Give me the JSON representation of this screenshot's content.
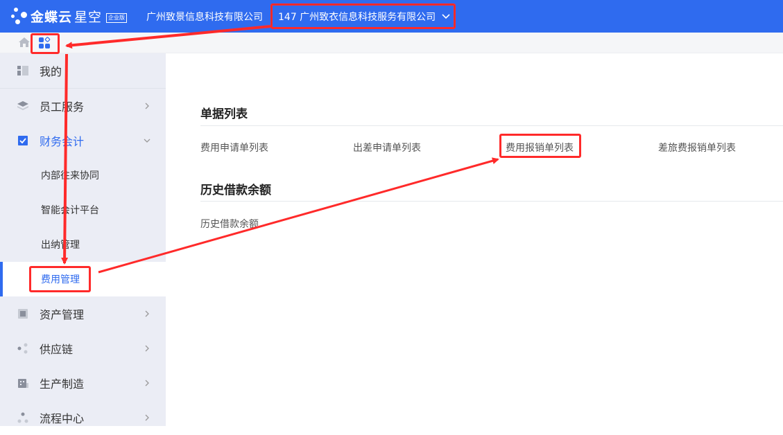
{
  "topbar": {
    "brand": "金蝶云",
    "brand_sub": "星空",
    "edition_badge": "企业版",
    "org_name": "广州致景信息科技有限公司",
    "account_selector": "147 广州致衣信息科技服务有限公司"
  },
  "breadcrumb": {
    "home_icon": "home-icon",
    "apps_icon": "apps-grid-icon"
  },
  "sidebar": {
    "items": [
      {
        "label": "我的",
        "icon": "dashboard-icon"
      },
      {
        "label": "员工服务",
        "icon": "layers-icon"
      },
      {
        "label": "财务会计",
        "icon": "ledger-icon"
      },
      {
        "label": "资产管理",
        "icon": "asset-icon"
      },
      {
        "label": "供应链",
        "icon": "supply-chain-icon"
      },
      {
        "label": "生产制造",
        "icon": "factory-icon"
      },
      {
        "label": "流程中心",
        "icon": "flow-icon"
      }
    ],
    "finance_subitems": [
      {
        "label": "内部往来协同"
      },
      {
        "label": "智能会计平台"
      },
      {
        "label": "出纳管理"
      },
      {
        "label": "费用管理"
      }
    ]
  },
  "main": {
    "sections": [
      {
        "title": "单据列表",
        "links": [
          "费用申请单列表",
          "出差申请单列表",
          "费用报销单列表",
          "差旅费报销单列表"
        ]
      },
      {
        "title": "历史借款余额",
        "links": [
          "历史借款余额"
        ]
      }
    ]
  },
  "colors": {
    "primary": "#2f6bef",
    "sidebar_bg": "#ebedf5",
    "annotation_red": "#ff2a2a"
  }
}
